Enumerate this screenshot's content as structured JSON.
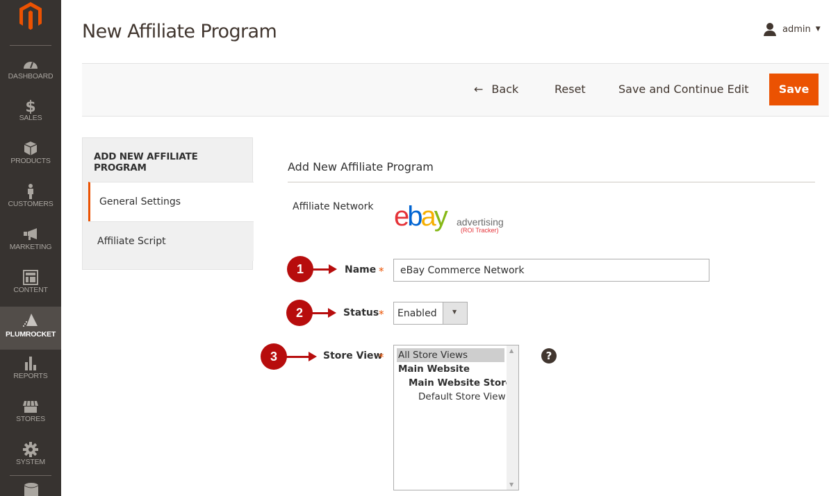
{
  "sidebar": {
    "items": [
      {
        "label": "DASHBOARD",
        "icon": "dashboard-gauge-icon"
      },
      {
        "label": "SALES",
        "icon": "dollar-icon"
      },
      {
        "label": "PRODUCTS",
        "icon": "box-icon"
      },
      {
        "label": "CUSTOMERS",
        "icon": "person-icon"
      },
      {
        "label": "MARKETING",
        "icon": "megaphone-icon"
      },
      {
        "label": "CONTENT",
        "icon": "layout-icon"
      },
      {
        "label": "PLUMROCKET",
        "icon": "pyramid-icon",
        "active": true
      },
      {
        "label": "REPORTS",
        "icon": "bar-chart-icon"
      },
      {
        "label": "STORES",
        "icon": "storefront-icon"
      },
      {
        "label": "SYSTEM",
        "icon": "gear-icon"
      }
    ]
  },
  "header": {
    "title": "New Affiliate Program",
    "user": "admin"
  },
  "actions": {
    "back": "Back",
    "reset": "Reset",
    "save_continue": "Save and Continue Edit",
    "save": "Save"
  },
  "tabs": {
    "title": "ADD NEW AFFILIATE PROGRAM",
    "items": [
      "General Settings",
      "Affiliate Script"
    ]
  },
  "form": {
    "fieldset_title": "Add New Affiliate Program",
    "network_label": "Affiliate Network",
    "network_logo": {
      "brand": "ebay",
      "tag": "advertising",
      "sub": "(ROI Tracker)"
    },
    "name_label": "Name",
    "name_value": "eBay Commerce Network",
    "status_label": "Status",
    "status_value": "Enabled",
    "store_label": "Store View",
    "store_options": [
      "All Store Views",
      "Main Website",
      "Main Website Store",
      "Default Store View"
    ],
    "store_selected": "All Store Views",
    "required_mark": "*",
    "help": "?"
  },
  "markers": [
    "1",
    "2",
    "3"
  ],
  "colors": {
    "accent": "#eb5202",
    "sidebar_bg": "#373330",
    "marker": "#b70d0d"
  }
}
